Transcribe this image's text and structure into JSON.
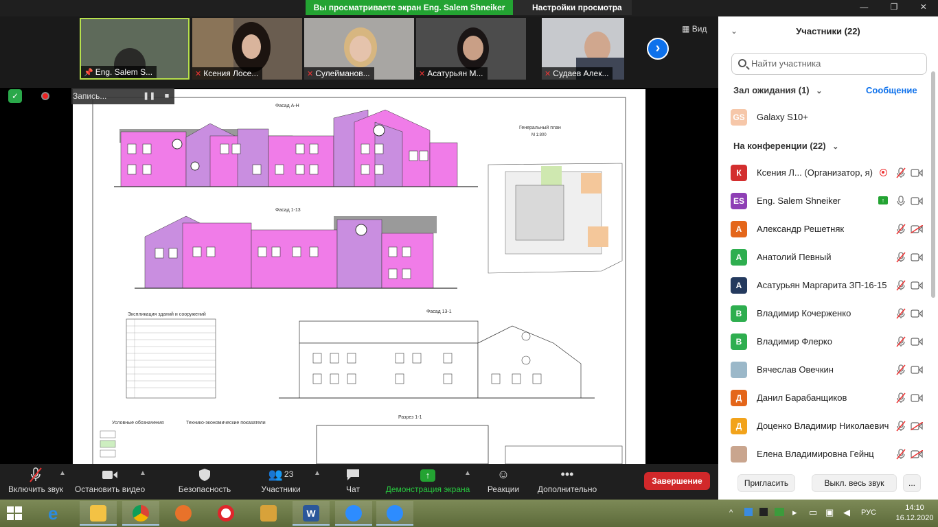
{
  "share_banner": {
    "viewing_text": "Вы просматриваете экран Eng. Salem Shneiker",
    "view_options": "Настройки просмотра"
  },
  "video_strip": {
    "tiles": [
      {
        "name": "Eng. Salem S...",
        "pinned": true
      },
      {
        "name": "Ксения Лосе...",
        "muted": true
      },
      {
        "name": "Сулейманов...",
        "muted": true
      },
      {
        "name": "Асатурьян М...",
        "muted": true
      },
      {
        "name": "Судаев Алек...",
        "muted": true
      }
    ],
    "view_label": "Вид"
  },
  "recording": {
    "label": "Запись..."
  },
  "drawing": {
    "facade_a_n": "Фасад А-Н",
    "facade_1_13": "Фасад 1-13",
    "facade_13_1": "Фасад 13-1",
    "site_plan": "Генеральный план",
    "site_scale": "М 1:800",
    "explication": "Экспликация зданий и сооружений",
    "legend": "Условные обозначения",
    "tep": "Технико-экономические показатели",
    "section": "Разрез 1-1"
  },
  "toolbar": {
    "mute": "Включить звук",
    "stop_video": "Остановить видео",
    "security": "Безопасность",
    "participants": "Участники",
    "participants_count": "23",
    "chat": "Чат",
    "share_screen": "Демонстрация экрана",
    "reactions": "Реакции",
    "more": "Дополнительно",
    "end": "Завершение"
  },
  "panel": {
    "title": "Участники (22)",
    "search_placeholder": "Найти участника",
    "waiting_room": "Зал ожидания (1)",
    "message": "Сообщение",
    "waiting": [
      {
        "initials": "GS",
        "name": "Galaxy S10+",
        "color": "#f6c7a9"
      }
    ],
    "in_meeting": "На конференции (22)",
    "participants": [
      {
        "initials": "К",
        "name": "Ксения Л...  (Организатор, я)",
        "color": "#d32f2f"
      },
      {
        "initials": "ES",
        "name": "Eng. Salem Shneiker",
        "color": "#8e3fb5"
      },
      {
        "initials": "А",
        "name": "Александр Решетняк",
        "color": "#e4661a"
      },
      {
        "initials": "А",
        "name": "Анатолий Певный",
        "color": "#2eae4f"
      },
      {
        "initials": "А",
        "name": "Асатурьян Маргарита ЗП-16-15",
        "color": "#243a5e"
      },
      {
        "initials": "В",
        "name": "Владимир Кочерженко",
        "color": "#2eae4f"
      },
      {
        "initials": "В",
        "name": "Владимир Флерко",
        "color": "#2eae4f"
      },
      {
        "initials": "",
        "name": "Вячеслав Овечкин",
        "color": "#9bb8c9"
      },
      {
        "initials": "Д",
        "name": "Данил Барабанщиков",
        "color": "#e4661a"
      },
      {
        "initials": "Д",
        "name": "Доценко Владимир Николаевич",
        "color": "#f2a31b"
      },
      {
        "initials": "",
        "name": "Елена Владимировна Гейнц",
        "color": "#c9a58e"
      }
    ],
    "invite": "Пригласить",
    "mute_all": "Выкл. весь звук",
    "more": "..."
  },
  "taskbar": {
    "lang": "РУС",
    "time": "14:10",
    "date": "16.12.2020"
  }
}
